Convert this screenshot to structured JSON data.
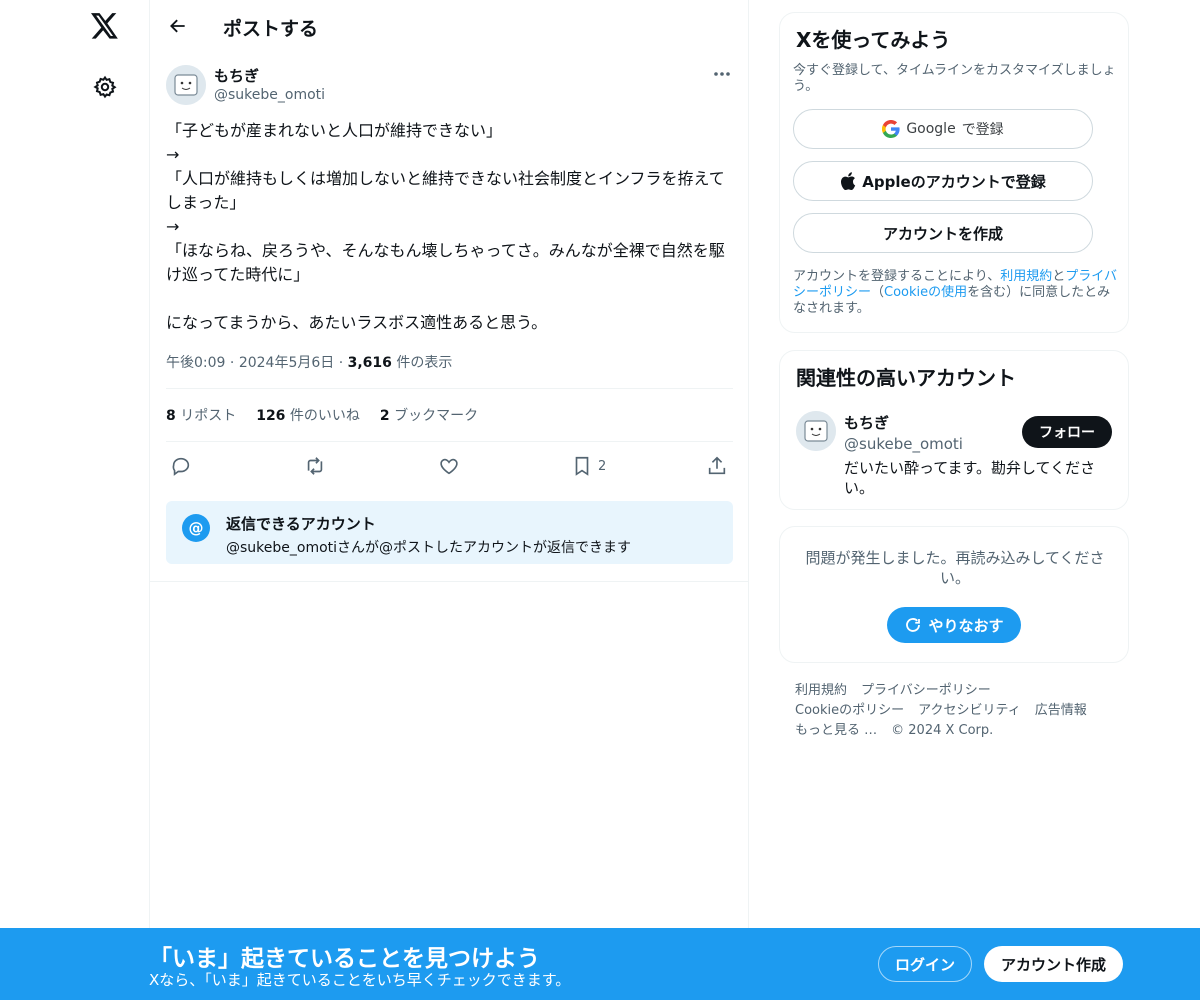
{
  "header": {
    "title": "ポストする"
  },
  "post": {
    "author_name": "もちぎ",
    "author_handle": "@sukebe_omoti",
    "text": "「子どもが産まれないと人口が維持できない」\n→\n「人口が維持もしくは増加しないと維持できない社会制度とインフラを拵えてしまった」\n→\n「ほならね、戻ろうや、そんなもん壊しちゃってさ。みんなが全裸で自然を駆け巡ってた時代に」\n\nになってまうから、あたいラスボス適性あると思う。",
    "time": "午後0:09",
    "date": "2024年5月6日",
    "views_count": "3,616",
    "views_label": "件の表示",
    "reposts_count": "8",
    "reposts_label": "リポスト",
    "likes_count": "126",
    "likes_label": "件のいいね",
    "bookmarks_count": "2",
    "bookmarks_label": "ブックマーク",
    "bookmark_action_count": "2"
  },
  "reply_restriction": {
    "title": "返信できるアカウント",
    "subtitle": "@sukebe_omotiさんが@ポストしたアカウントが返信できます"
  },
  "signup_card": {
    "title": "Xを使ってみよう",
    "subtitle": "今すぐ登録して、タイムラインをカスタマイズしましょう。",
    "google_label": "Google",
    "google_suffix": "で登録",
    "apple_label": "Appleのアカウントで登録",
    "create_label": "アカウントを作成",
    "terms_prefix": "アカウントを登録することにより、",
    "terms_link1": "利用規約",
    "terms_mid1": "と",
    "terms_link2": "プライバシーポリシー",
    "terms_mid2": "（",
    "terms_link3": "Cookieの使用",
    "terms_suffix": "を含む）に同意したとみなされます。"
  },
  "relevant_card": {
    "title": "関連性の高いアカウント",
    "name": "もちぎ",
    "handle": "@sukebe_omoti",
    "bio": "だいたい酔ってます。勘弁してください。",
    "follow_label": "フォロー"
  },
  "error_card": {
    "message": "問題が発生しました。再読み込みしてください。",
    "retry_label": "やりなおす"
  },
  "footer": {
    "links": [
      "利用規約",
      "プライバシーポリシー",
      "Cookieのポリシー",
      "アクセシビリティ",
      "広告情報",
      "もっと見る …",
      "© 2024 X Corp."
    ]
  },
  "bottom_bar": {
    "title": "「いま」起きていることを見つけよう",
    "subtitle": "Xなら、「いま」起きていることをいち早くチェックできます。",
    "login_label": "ログイン",
    "signup_label": "アカウント作成"
  },
  "colors": {
    "accent": "#1d9bf0",
    "text": "#0f1419",
    "muted": "#536471",
    "border": "#eff3f4"
  }
}
